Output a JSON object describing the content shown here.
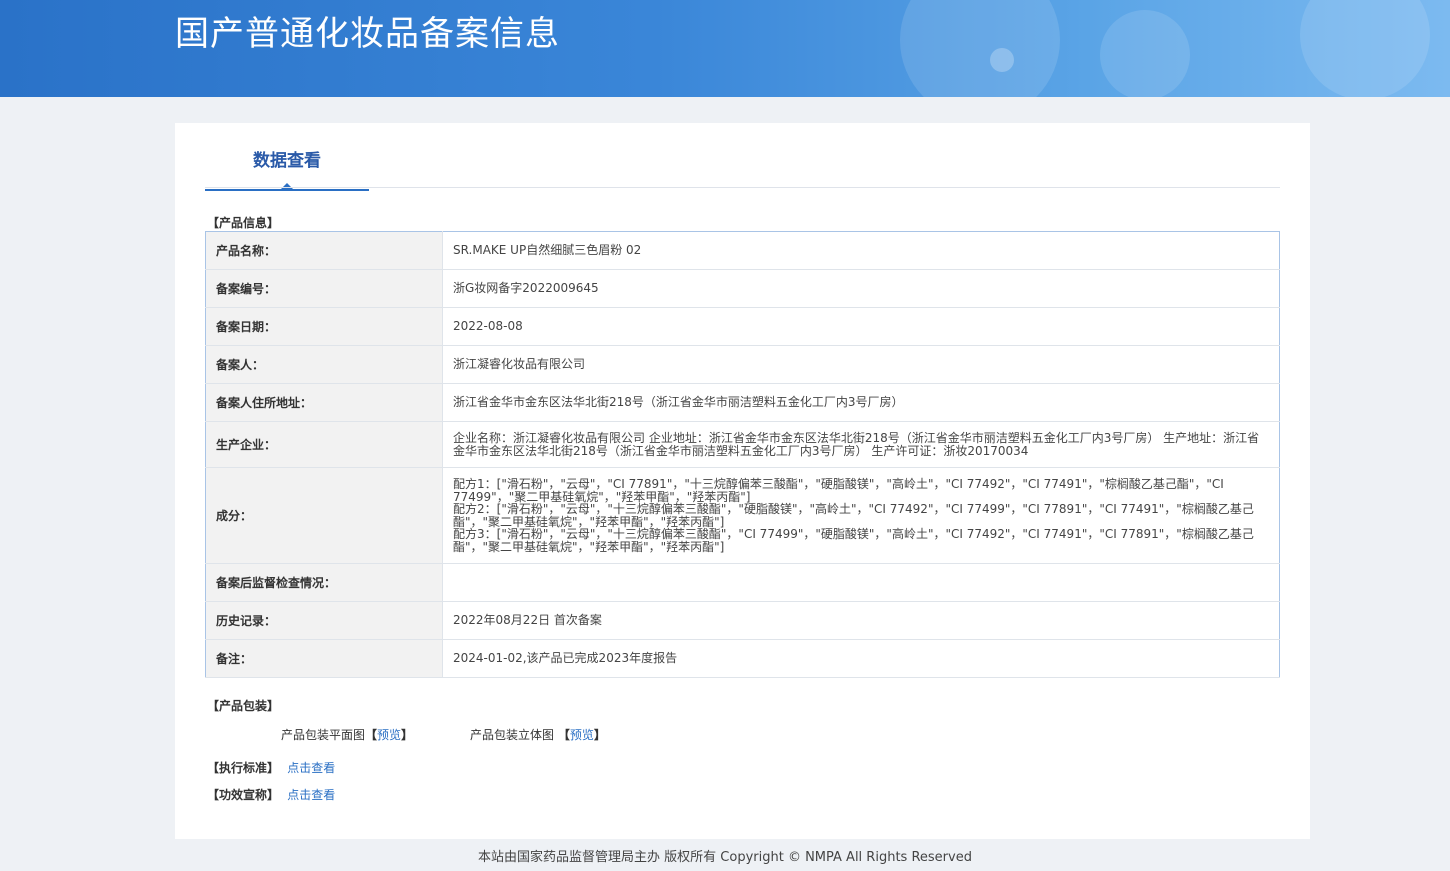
{
  "header": {
    "title": "国产普通化妆品备案信息"
  },
  "tabs": {
    "active": "数据查看"
  },
  "sections": {
    "product_info": "【产品信息】",
    "packaging": "【产品包装】",
    "standard": "【执行标准】",
    "claims": "【功效宣称】"
  },
  "product": {
    "rows": [
      {
        "key": "产品名称：",
        "value": "SR.MAKE UP自然细腻三色眉粉 02"
      },
      {
        "key": "备案编号：",
        "value": "浙G妆网备字2022009645"
      },
      {
        "key": "备案日期：",
        "value": "2022-08-08"
      },
      {
        "key": "备案人：",
        "value": "浙江凝睿化妆品有限公司"
      },
      {
        "key": "备案人住所地址：",
        "value": "浙江省金华市金东区法华北街218号（浙江省金华市丽洁塑料五金化工厂内3号厂房）"
      },
      {
        "key": "生产企业：",
        "value": "企业名称：浙江凝睿化妆品有限公司 企业地址：浙江省金华市金东区法华北街218号（浙江省金华市丽洁塑料五金化工厂内3号厂房） 生产地址：浙江省金华市金东区法华北街218号（浙江省金华市丽洁塑料五金化工厂内3号厂房） 生产许可证：浙妆20170034"
      },
      {
        "key": "成分：",
        "value_lines": [
          "配方1：[\"滑石粉\"，\"云母\"，\"CI 77891\"，\"十三烷醇偏苯三酸酯\"，\"硬脂酸镁\"，\"高岭土\"，\"CI 77492\"，\"CI 77491\"，\"棕榈酸乙基己酯\"，\"CI 77499\"，\"聚二甲基硅氧烷\"，\"羟苯甲酯\"，\"羟苯丙酯\"]",
          "配方2：[\"滑石粉\"，\"云母\"，\"十三烷醇偏苯三酸酯\"，\"硬脂酸镁\"，\"高岭土\"，\"CI 77492\"，\"CI 77499\"，\"CI 77891\"，\"CI 77491\"，\"棕榈酸乙基己酯\"，\"聚二甲基硅氧烷\"，\"羟苯甲酯\"，\"羟苯丙酯\"]",
          "配方3：[\"滑石粉\"，\"云母\"，\"十三烷醇偏苯三酸酯\"，\"CI 77499\"，\"硬脂酸镁\"，\"高岭土\"，\"CI 77492\"，\"CI 77491\"，\"CI 77891\"，\"棕榈酸乙基己酯\"，\"聚二甲基硅氧烷\"，\"羟苯甲酯\"，\"羟苯丙酯\"]"
        ]
      },
      {
        "key": "备案后监督检查情况：",
        "value": ""
      },
      {
        "key": "历史记录：",
        "value": "2022年08月22日 首次备案"
      },
      {
        "key": "备注：",
        "value": "2024-01-02,该产品已完成2023年度报告"
      }
    ]
  },
  "packaging": {
    "flat_label": "产品包装平面图",
    "flat_preview": "预览",
    "stereo_label": "产品包装立体图",
    "stereo_preview": "预览",
    "bracket_open": "【",
    "bracket_close": "】"
  },
  "links": {
    "standard_view": "点击查看",
    "claims_view": "点击查看"
  },
  "footer": {
    "text": "本站由国家药品监督管理局主办 版权所有 Copyright © NMPA All Rights Reserved"
  },
  "colors": {
    "banner": "#3a86d8",
    "link": "#2a6fc4",
    "accent": "#2a5aa8"
  }
}
